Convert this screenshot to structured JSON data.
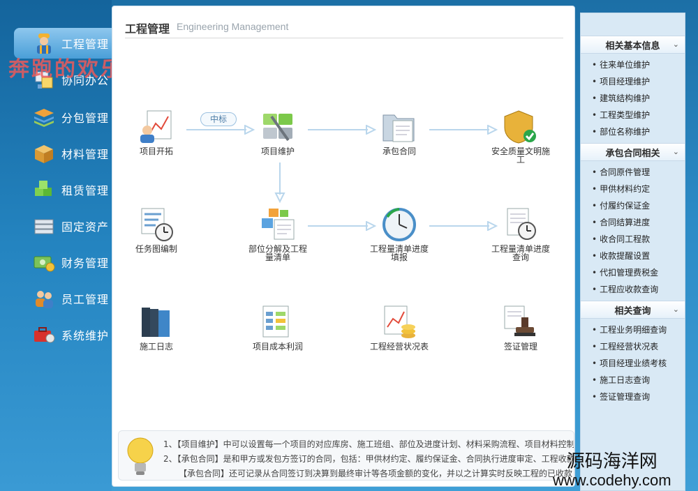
{
  "nav": {
    "items": [
      {
        "label": "工程管理",
        "icon": "worker-icon"
      },
      {
        "label": "协同办公",
        "icon": "office-icon"
      },
      {
        "label": "分包管理",
        "icon": "layers-icon"
      },
      {
        "label": "材料管理",
        "icon": "box-icon"
      },
      {
        "label": "租赁管理",
        "icon": "cubes-icon"
      },
      {
        "label": "固定资产",
        "icon": "server-icon"
      },
      {
        "label": "财务管理",
        "icon": "money-icon"
      },
      {
        "label": "员工管理",
        "icon": "users-icon"
      },
      {
        "label": "系统维护",
        "icon": "toolbox-icon"
      }
    ],
    "active_index": 0
  },
  "watermark": "奔跑的欢乐豆",
  "header": {
    "title_cn": "工程管理",
    "title_en": "Engineering Management"
  },
  "flow": {
    "tag": "中标",
    "nodes": [
      {
        "label": "项目开拓",
        "icon": "project-start-icon"
      },
      {
        "label": "项目维护",
        "icon": "maintenance-icon"
      },
      {
        "label": "承包合同",
        "icon": "contract-folder-icon"
      },
      {
        "label": "安全质量文明施工",
        "icon": "safety-shield-icon"
      },
      {
        "label": "任务图编制",
        "icon": "task-chart-icon"
      },
      {
        "label": "部位分解及工程量清单",
        "icon": "decompose-icon"
      },
      {
        "label": "工程量清单进度填报",
        "icon": "progress-clock-icon"
      },
      {
        "label": "工程量清单进度查询",
        "icon": "progress-query-icon"
      },
      {
        "label": "施工日志",
        "icon": "log-book-icon"
      },
      {
        "label": "项目成本利润",
        "icon": "cost-profit-icon"
      },
      {
        "label": "工程经营状况表",
        "icon": "business-report-icon"
      },
      {
        "label": "签证管理",
        "icon": "stamp-icon"
      }
    ]
  },
  "tips": {
    "lines": [
      "1、【项目维护】中可以设置每一个项目的对应库房、施工班组、部位及进度计划、材料采购流程、项目材料控制",
      "2、【承包合同】是和甲方或发包方签订的合同，包括：甲供材约定、履约保证金、合同执行进度审定、工程收款",
      "【承包合同】还可记录从合同签订到决算到最终审计等各项金额的变化，并以之计算实时反映工程的已收款"
    ]
  },
  "panel": {
    "sections": [
      {
        "title": "相关基本信息",
        "links": [
          "往来单位维护",
          "项目经理维护",
          "建筑结构维护",
          "工程类型维护",
          "部位名称维护"
        ]
      },
      {
        "title": "承包合同相关",
        "links": [
          "合同原件管理",
          "甲供材料约定",
          "付履约保证金",
          "合同结算进度",
          "收合同工程款",
          "收款提醒设置",
          "代扣管理费税金",
          "工程应收款查询"
        ]
      },
      {
        "title": "相关查询",
        "links": [
          "工程业务明细查询",
          "工程经营状况表",
          "项目经理业绩考核",
          "施工日志查询",
          "签证管理查询"
        ]
      }
    ]
  },
  "site_mark": {
    "name": "源码海洋网",
    "url": "www.codehy.com"
  },
  "colors": {
    "accent": "#2c8bc6",
    "arrow": "#b9d6ec",
    "panel_bg": "#d9e9f5"
  }
}
